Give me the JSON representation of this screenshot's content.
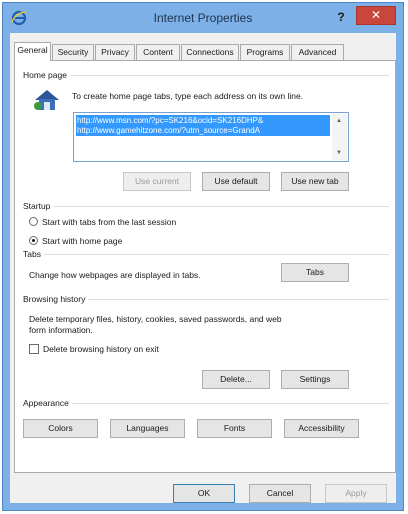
{
  "window": {
    "title": "Internet Properties",
    "help_label": "?",
    "close_label": "✕"
  },
  "tabs": [
    {
      "label": "General"
    },
    {
      "label": "Security"
    },
    {
      "label": "Privacy"
    },
    {
      "label": "Content"
    },
    {
      "label": "Connections"
    },
    {
      "label": "Programs"
    },
    {
      "label": "Advanced"
    }
  ],
  "home_page": {
    "group_label": "Home page",
    "instruction": "To create home page tabs, type each address on its own line.",
    "urls": [
      "http://www.msn.com/?pc=SK216&ocid=SK216DHP&",
      "http://www.gamehitzone.com/?utm_source=GrandA"
    ],
    "use_current_label": "Use current",
    "use_default_label": "Use default",
    "use_new_tab_label": "Use new tab"
  },
  "startup": {
    "group_label": "Startup",
    "option_last_session": "Start with tabs from the last session",
    "option_home_page": "Start with home page",
    "selected": "home_page"
  },
  "tabs_section": {
    "group_label": "Tabs",
    "description": "Change how webpages are displayed in tabs.",
    "button_label": "Tabs"
  },
  "browsing_history": {
    "group_label": "Browsing history",
    "description_line1": "Delete temporary files, history, cookies, saved passwords, and web",
    "description_line2": "form information.",
    "delete_on_exit_label": "Delete browsing history on exit",
    "delete_on_exit_checked": false,
    "delete_label": "Delete...",
    "settings_label": "Settings"
  },
  "appearance": {
    "group_label": "Appearance",
    "colors_label": "Colors",
    "languages_label": "Languages",
    "fonts_label": "Fonts",
    "accessibility_label": "Accessibility"
  },
  "footer": {
    "ok_label": "OK",
    "cancel_label": "Cancel",
    "apply_label": "Apply"
  },
  "colors": {
    "title_bar": "#7cb0e6",
    "close_button": "#c9463d",
    "selection": "#3399ff"
  }
}
